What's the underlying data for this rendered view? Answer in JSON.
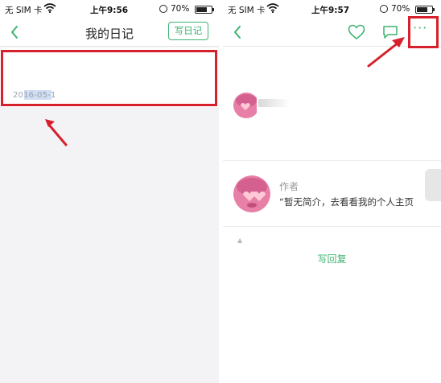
{
  "left_screen": {
    "status_bar": {
      "carrier": "无 SIM 卡",
      "time": "上午9:56",
      "battery_percent": "70%",
      "battery_level": 0.7
    },
    "navbar": {
      "title": "我的日记",
      "write_button_label": "写日记"
    },
    "diary_list": [
      {
        "date": "2016-05-1"
      }
    ]
  },
  "right_screen": {
    "status_bar": {
      "carrier": "无 SIM 卡",
      "time": "上午9:57",
      "battery_percent": "70%",
      "battery_level": 0.7
    },
    "navbar": {
      "more_label": "···"
    },
    "author": {
      "label": "作者",
      "intro": "“暂无简介，去看看我的个人主页"
    },
    "reply_label": "写回复"
  },
  "colors": {
    "accent_green": "#3cb371",
    "annotation_red": "#d6202b",
    "list_background": "#f3f3f5"
  }
}
